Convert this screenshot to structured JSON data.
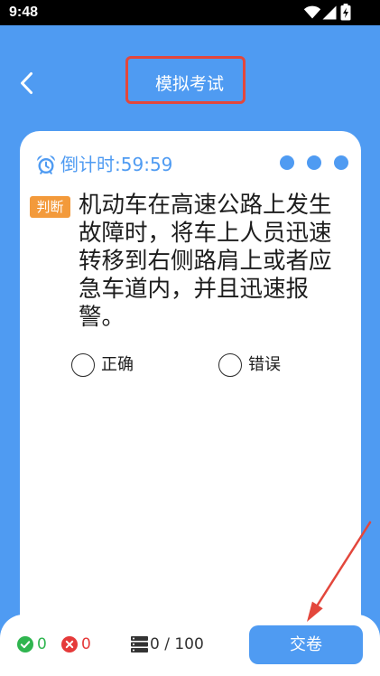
{
  "status_bar": {
    "time": "9:48",
    "icons": [
      "wifi-icon",
      "signal-icon",
      "battery-charging-icon"
    ]
  },
  "header": {
    "back_icon": "back-arrow-icon",
    "title": "模拟考试"
  },
  "card": {
    "timer": {
      "icon": "alarm-clock-icon",
      "label": "倒计时:",
      "remaining": "59:59"
    },
    "more_icon": "more-dots-icon",
    "question": {
      "type": "判断",
      "text": "机动车在高速公路上发生故障时，将车上人员迅速转移到右侧路肩上或者应急车道内，并且迅速报警。"
    },
    "options": [
      {
        "label": "正确",
        "selected": false
      },
      {
        "label": "错误",
        "selected": false
      }
    ]
  },
  "footer": {
    "correct": {
      "icon": "check-circle-icon",
      "count": "0"
    },
    "wrong": {
      "icon": "close-circle-icon",
      "count": "0"
    },
    "progress": {
      "icon": "answer-sheet-icon",
      "text": "0 / 100"
    },
    "submit_label": "交卷"
  },
  "colors": {
    "primary": "#4f9bf2",
    "badge": "#f39a3b",
    "correct": "#2fb54f",
    "wrong": "#e53a3a",
    "annotation": "#e3473c",
    "text": "#1c1c1c",
    "muted": "#333333"
  }
}
